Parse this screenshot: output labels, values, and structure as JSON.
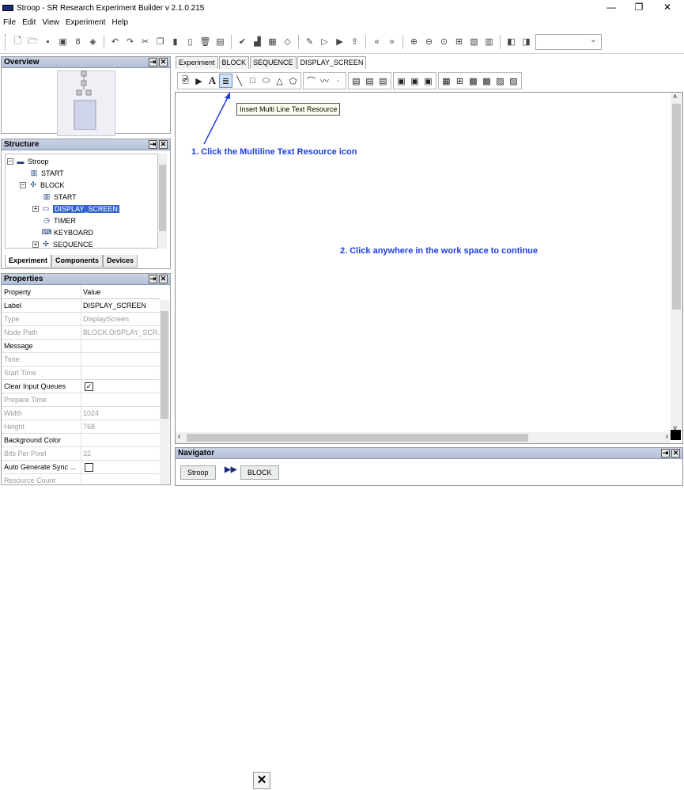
{
  "window": {
    "title": "Stroop - SR Research Experiment Builder v 2.1.0.215",
    "controls": [
      "—",
      "❐",
      "✕"
    ]
  },
  "menu": [
    "File",
    "Edit",
    "View",
    "Experiment",
    "Help"
  ],
  "toolbar": {
    "icons": [
      "new-file-icon",
      "open-folder-icon",
      "save-icon",
      "save-as-icon",
      "wrench-icon",
      "package-icon",
      "undo-icon",
      "redo-icon",
      "cut-icon",
      "copy-icon",
      "paste-icon",
      "clipboard-icon",
      "delete-icon",
      "properties-icon",
      "check-icon",
      "build-icon",
      "deploy-icon",
      "test-run-icon",
      "validate-icon",
      "run-icon",
      "play-icon",
      "export-icon",
      "rewind-icon",
      "fast-forward-icon",
      "zoom-in-icon",
      "zoom-out-icon",
      "zoom-fit-icon",
      "grid-icon",
      "snap-icon",
      "table-icon",
      "copy-format-icon",
      "paste-format-icon"
    ],
    "combo_value": ""
  },
  "overview": {
    "title": "Overview"
  },
  "structure": {
    "title": "Structure",
    "nodes": [
      {
        "label": "Stroop",
        "icon": "experiment-icon"
      },
      {
        "label": "START",
        "icon": "start-icon"
      },
      {
        "label": "BLOCK",
        "icon": "sequence-icon"
      },
      {
        "label": "START",
        "icon": "start-icon"
      },
      {
        "label": "DISPLAY_SCREEN",
        "icon": "display-screen-icon"
      },
      {
        "label": "TIMER",
        "icon": "timer-icon"
      },
      {
        "label": "KEYBOARD",
        "icon": "keyboard-icon"
      },
      {
        "label": "SEQUENCE",
        "icon": "sequence-icon"
      }
    ],
    "tabs": [
      "Experiment",
      "Components",
      "Devices"
    ]
  },
  "properties": {
    "title": "Properties",
    "headers": [
      "Property",
      "Value"
    ],
    "rows": [
      {
        "name": "Label",
        "value": "DISPLAY_SCREEN",
        "enabled": true
      },
      {
        "name": "Type",
        "value": "DisplayScreen",
        "enabled": false
      },
      {
        "name": "Node Path",
        "value": "BLOCK.DISPLAY_SCR...",
        "enabled": false
      },
      {
        "name": "Message",
        "value": "",
        "enabled": true
      },
      {
        "name": "Time",
        "value": "",
        "enabled": false
      },
      {
        "name": "Start Time",
        "value": "",
        "enabled": false
      },
      {
        "name": "Clear Input Queues",
        "value": "☑",
        "enabled": true
      },
      {
        "name": "Prepare Time",
        "value": "",
        "enabled": false
      },
      {
        "name": "Width",
        "value": "1024",
        "enabled": false
      },
      {
        "name": "Height",
        "value": "768",
        "enabled": false
      },
      {
        "name": "Background Color",
        "value": "",
        "enabled": true
      },
      {
        "name": "Bits Per Pixel",
        "value": "32",
        "enabled": false
      },
      {
        "name": "Auto Generate Sync ...",
        "value": "☐",
        "enabled": true
      },
      {
        "name": "Resource Count",
        "value": "",
        "enabled": false
      }
    ]
  },
  "editor_tabs": [
    "Experiment",
    "BLOCK",
    "SEQUENCE",
    "DISPLAY_SCREEN"
  ],
  "draw_toolbar": {
    "groups": [
      [
        "image-resource-icon",
        "video-resource-icon",
        "text-resource-icon",
        "multiline-text-resource-icon",
        "line-icon",
        "rectangle-icon",
        "ellipse-icon",
        "triangle-icon",
        "freeform-icon"
      ],
      [
        "arc-path-icon",
        "polyline-path-icon",
        "points-path-icon"
      ],
      [
        "align-left-icon",
        "align-center-icon",
        "align-right-icon"
      ],
      [
        "align-top-icon",
        "align-middle-icon",
        "align-bottom-icon"
      ],
      [
        "screen-grid-icon",
        "interest-area-icon",
        "auto-segment-icon",
        "auto-word-icon",
        "save-screen-icon",
        "load-screen-icon"
      ]
    ]
  },
  "workspace": {
    "tooltip": "Insert Multi Line Text Resource",
    "annotation1": "1. Click the Multiline Text Resource icon",
    "annotation2": "2. Click anywhere in the work space to continue"
  },
  "navigator": {
    "title": "Navigator",
    "crumbs": [
      "Stroop",
      "BLOCK"
    ],
    "separator": "▶▶"
  },
  "close_symbol": "✕",
  "colors": {
    "annotation": "#1f3ee0",
    "selection": "#3366cc",
    "header": "#b4c0d6"
  }
}
